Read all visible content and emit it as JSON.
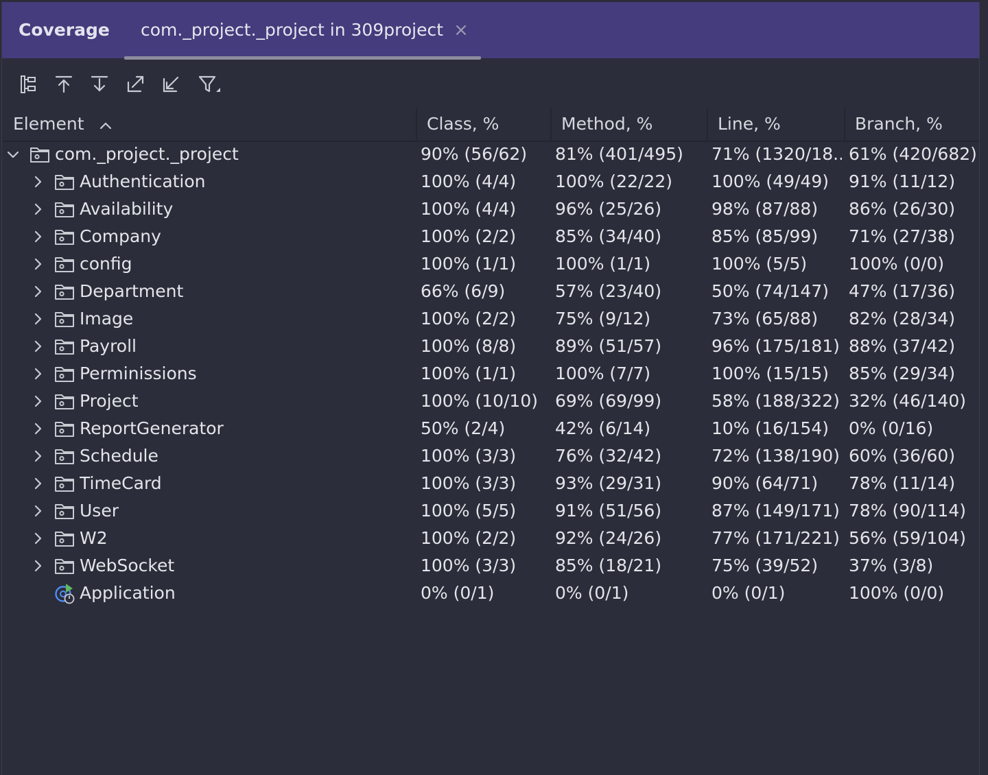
{
  "panel": {
    "title": "Coverage",
    "tab_label": "com._project._project in 309project",
    "close_glyph": "×"
  },
  "toolbar": {
    "icons": [
      "flatten-packages-icon",
      "navigate-up-icon",
      "navigate-down-icon",
      "export-icon",
      "import-icon",
      "filter-icon"
    ]
  },
  "columns": {
    "element": "Element",
    "class": "Class, %",
    "method": "Method, %",
    "line": "Line, %",
    "branch": "Branch, %"
  },
  "rows": [
    {
      "name": "com._project._project",
      "type": "root-package",
      "expanded": true,
      "class": "90% (56/62)",
      "method": "81% (401/495)",
      "line": "71% (1320/18...",
      "branch": "61% (420/682)"
    },
    {
      "name": "Authentication",
      "type": "package",
      "class": "100% (4/4)",
      "method": "100% (22/22)",
      "line": "100% (49/49)",
      "branch": "91% (11/12)"
    },
    {
      "name": "Availability",
      "type": "package",
      "class": "100% (4/4)",
      "method": "96% (25/26)",
      "line": "98% (87/88)",
      "branch": "86% (26/30)"
    },
    {
      "name": "Company",
      "type": "package",
      "class": "100% (2/2)",
      "method": "85% (34/40)",
      "line": "85% (85/99)",
      "branch": "71% (27/38)"
    },
    {
      "name": "config",
      "type": "package",
      "class": "100% (1/1)",
      "method": "100% (1/1)",
      "line": "100% (5/5)",
      "branch": "100% (0/0)"
    },
    {
      "name": "Department",
      "type": "package",
      "class": "66% (6/9)",
      "method": "57% (23/40)",
      "line": "50% (74/147)",
      "branch": "47% (17/36)"
    },
    {
      "name": "Image",
      "type": "package",
      "class": "100% (2/2)",
      "method": "75% (9/12)",
      "line": "73% (65/88)",
      "branch": "82% (28/34)"
    },
    {
      "name": "Payroll",
      "type": "package",
      "class": "100% (8/8)",
      "method": "89% (51/57)",
      "line": "96% (175/181)",
      "branch": "88% (37/42)"
    },
    {
      "name": "Perminissions",
      "type": "package",
      "class": "100% (1/1)",
      "method": "100% (7/7)",
      "line": "100% (15/15)",
      "branch": "85% (29/34)"
    },
    {
      "name": "Project",
      "type": "package",
      "class": "100% (10/10)",
      "method": "69% (69/99)",
      "line": "58% (188/322)",
      "branch": "32% (46/140)"
    },
    {
      "name": "ReportGenerator",
      "type": "package",
      "class": "50% (2/4)",
      "method": "42% (6/14)",
      "line": "10% (16/154)",
      "branch": "0% (0/16)"
    },
    {
      "name": "Schedule",
      "type": "package",
      "class": "100% (3/3)",
      "method": "76% (32/42)",
      "line": "72% (138/190)",
      "branch": "60% (36/60)"
    },
    {
      "name": "TimeCard",
      "type": "package",
      "class": "100% (3/3)",
      "method": "93% (29/31)",
      "line": "90% (64/71)",
      "branch": "78% (11/14)"
    },
    {
      "name": "User",
      "type": "package",
      "class": "100% (5/5)",
      "method": "91% (51/56)",
      "line": "87% (149/171)",
      "branch": "78% (90/114)"
    },
    {
      "name": "W2",
      "type": "package",
      "class": "100% (2/2)",
      "method": "92% (24/26)",
      "line": "77% (171/221)",
      "branch": "56% (59/104)"
    },
    {
      "name": "WebSocket",
      "type": "package",
      "class": "100% (3/3)",
      "method": "85% (18/21)",
      "line": "75% (39/52)",
      "branch": "37% (3/8)"
    },
    {
      "name": "Application",
      "type": "spring-boot-class",
      "class": "0% (0/1)",
      "method": "0% (0/1)",
      "line": "0% (0/1)",
      "branch": "100% (0/0)"
    }
  ],
  "colors": {
    "tab_bar": "#443c7c",
    "background": "#2b2d3a",
    "text": "#e3e5ea",
    "icon": "#c9cbd3",
    "app_icon_blue": "#4e8df5",
    "app_icon_green": "#5fb85f"
  }
}
